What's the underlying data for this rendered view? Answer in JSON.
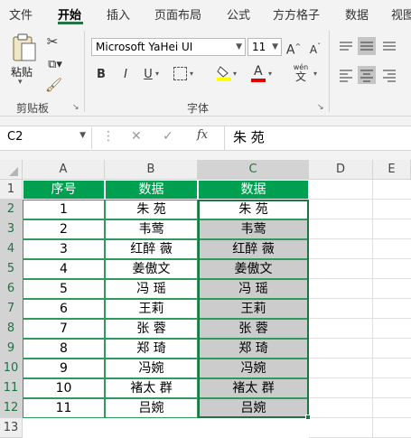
{
  "ribbon": {
    "tabs": [
      "文件",
      "开始",
      "插入",
      "页面布局",
      "公式",
      "方方格子",
      "数据",
      "视图"
    ],
    "active_tab": "开始",
    "clipboard": {
      "paste_label": "粘贴",
      "group_label": "剪贴板"
    },
    "font": {
      "font_name": "Microsoft YaHei UI",
      "font_size": "11",
      "group_label": "字体",
      "bold": "B",
      "italic": "I",
      "underline": "U",
      "color_letter": "A",
      "wen": "wén",
      "wen_char": "文"
    }
  },
  "formula_bar": {
    "name_box": "C2",
    "fx": "fx",
    "value": "朱 苑"
  },
  "grid": {
    "columns": [
      "A",
      "B",
      "C",
      "D",
      "E"
    ],
    "rows": [
      "1",
      "2",
      "3",
      "4",
      "5",
      "6",
      "7",
      "8",
      "9",
      "10",
      "11",
      "12",
      "13"
    ],
    "header": {
      "a": "序号",
      "b": "数据",
      "c": "数据"
    },
    "data": [
      {
        "a": "1",
        "b": "朱 苑",
        "c": "朱 苑"
      },
      {
        "a": "2",
        "b": "韦莺",
        "c": "韦莺"
      },
      {
        "a": "3",
        "b": "红醉 薇",
        "c": "红醉 薇"
      },
      {
        "a": "4",
        "b": "姜傲文",
        "c": "姜傲文"
      },
      {
        "a": "5",
        "b": "冯 瑶",
        "c": "冯 瑶"
      },
      {
        "a": "6",
        "b": "王莉",
        "c": "王莉"
      },
      {
        "a": "7",
        "b": "张 蓉",
        "c": "张 蓉"
      },
      {
        "a": "8",
        "b": "郑 琦",
        "c": "郑 琦"
      },
      {
        "a": "9",
        "b": "冯婉",
        "c": "冯婉"
      },
      {
        "a": "10",
        "b": "褚太 群",
        "c": "褚太 群"
      },
      {
        "a": "11",
        "b": "吕婉",
        "c": "吕婉"
      }
    ]
  },
  "colors": {
    "accent": "#217346",
    "header_fill": "#00a050",
    "selection_fill": "#cccccc"
  }
}
